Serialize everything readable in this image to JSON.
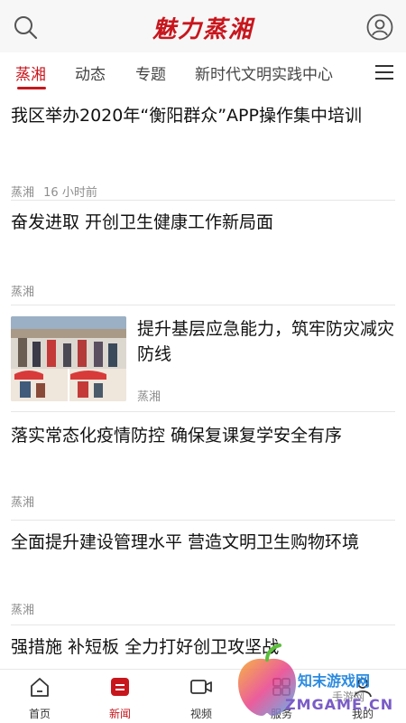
{
  "header": {
    "brand": "魅力蒸湘"
  },
  "icons": {
    "search": "search-icon",
    "user": "user-circle-icon",
    "menu": "menu-icon"
  },
  "tabs": [
    {
      "label": "蒸湘",
      "active": true
    },
    {
      "label": "动态"
    },
    {
      "label": "专题"
    },
    {
      "label": "新时代文明实践中心"
    }
  ],
  "feed": [
    {
      "title": "我区举办2020年“衡阳群众”APP操作集中培训",
      "source": "蒸湘",
      "time": "16 小时前"
    },
    {
      "title": "奋发进取 开创卫生健康工作新局面",
      "source": "蒸湘"
    },
    {
      "title": "提升基层应急能力，筑牢防灾减灾防线",
      "source": "蒸湘",
      "has_image": true
    },
    {
      "title": "落实常态化疫情防控 确保复课复学安全有序",
      "source": "蒸湘"
    },
    {
      "title": "全面提升建设管理水平 营造文明卫生购物环境",
      "source": "蒸湘"
    },
    {
      "title": "强措施 补短板 全力打好创卫攻坚战"
    }
  ],
  "bottom_nav": [
    {
      "label": "首页",
      "icon": "home-icon"
    },
    {
      "label": "新闻",
      "icon": "news-icon",
      "active": true
    },
    {
      "label": "视频",
      "icon": "video-icon"
    },
    {
      "label": "服务",
      "icon": "service-icon"
    },
    {
      "label": "我的",
      "icon": "profile-icon"
    }
  ],
  "watermark": {
    "line1": "知末游戏网",
    "line2": "手游网",
    "line3": "ZMGAME.CN"
  },
  "colors": {
    "accent": "#c8161d",
    "meta": "#8e8e8e",
    "divider": "#e6e6e6"
  }
}
